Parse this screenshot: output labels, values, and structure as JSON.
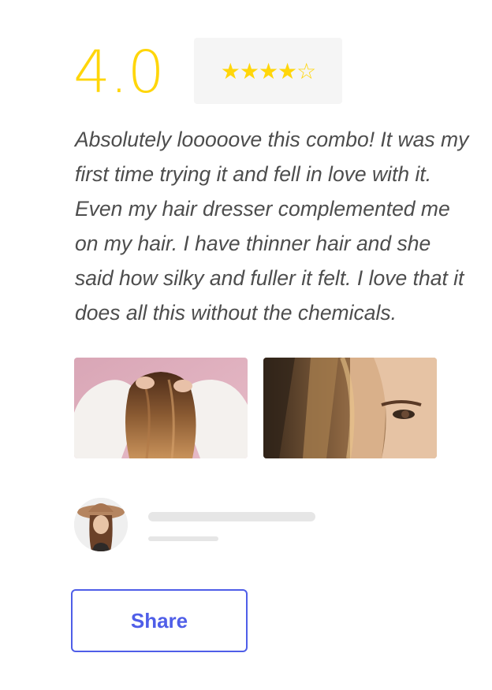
{
  "review": {
    "score": "4.0",
    "stars": "★★★★☆",
    "rating_value": 4,
    "rating_max": 5,
    "text": "Absolutely looooove this combo! It was my first time trying it and fell in love with it. Even my hair dresser complemented me on my hair. I have thinner hair and she said how silky and fuller it felt. I love that it does all this without the chemicals."
  },
  "photos": [
    {
      "subject": "woman-with-wavy-hair-back-view"
    },
    {
      "subject": "woman-face-closeup-hair"
    }
  ],
  "reviewer": {
    "avatar_subject": "woman-in-brown-hat"
  },
  "actions": {
    "share_label": "Share"
  },
  "colors": {
    "accent_star": "#FFD60A",
    "button_primary": "#4F5EE8",
    "text": "#4D4D4D",
    "skeleton": "#E6E6E6"
  }
}
